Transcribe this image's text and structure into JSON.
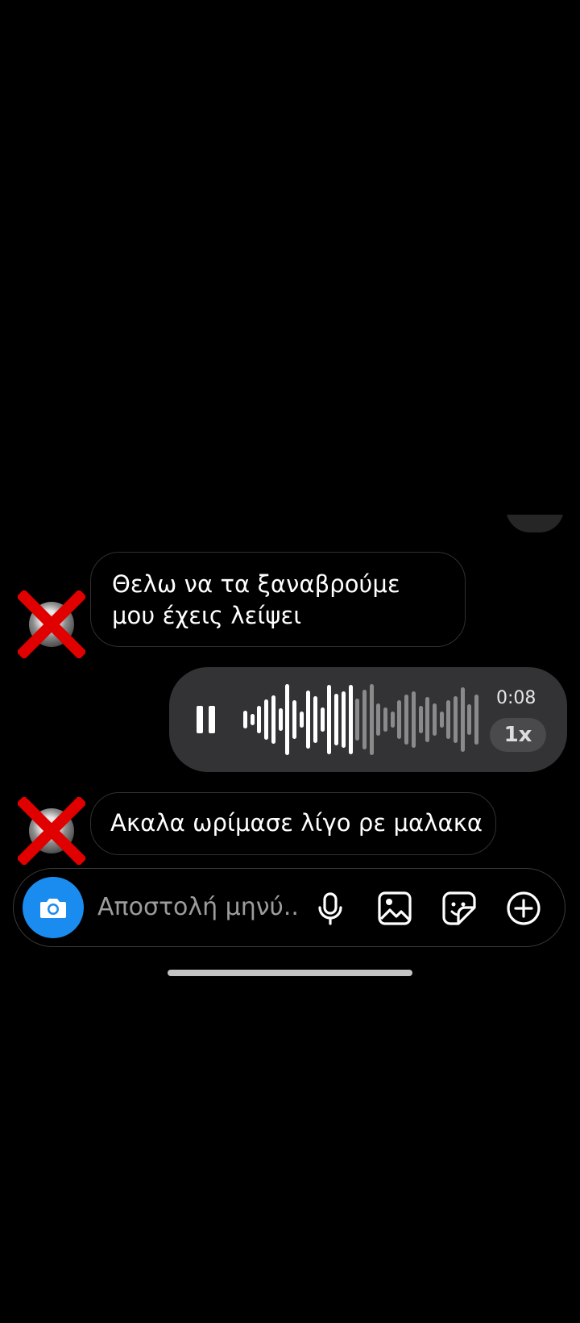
{
  "messages": [
    {
      "sender": "other",
      "text": "Θελω να τα ξαναβρούμε μου έχεις λείψει"
    },
    {
      "sender": "me",
      "type": "voice",
      "duration": "0:08",
      "speed": "1x",
      "playback_progress": 0.45
    },
    {
      "sender": "other",
      "text": "Ακαλα ωρίμασε λίγο ρε μαλακα"
    }
  ],
  "composer": {
    "placeholder": "Αποστολή μηνύ...",
    "icons": [
      "camera-icon",
      "microphone-icon",
      "gallery-icon",
      "sticker-icon",
      "plus-icon"
    ]
  },
  "colors": {
    "background": "#000000",
    "voice_bubble": "#333335",
    "camera_button": "#1a8cf0",
    "avatar_cross": "#e00000"
  }
}
